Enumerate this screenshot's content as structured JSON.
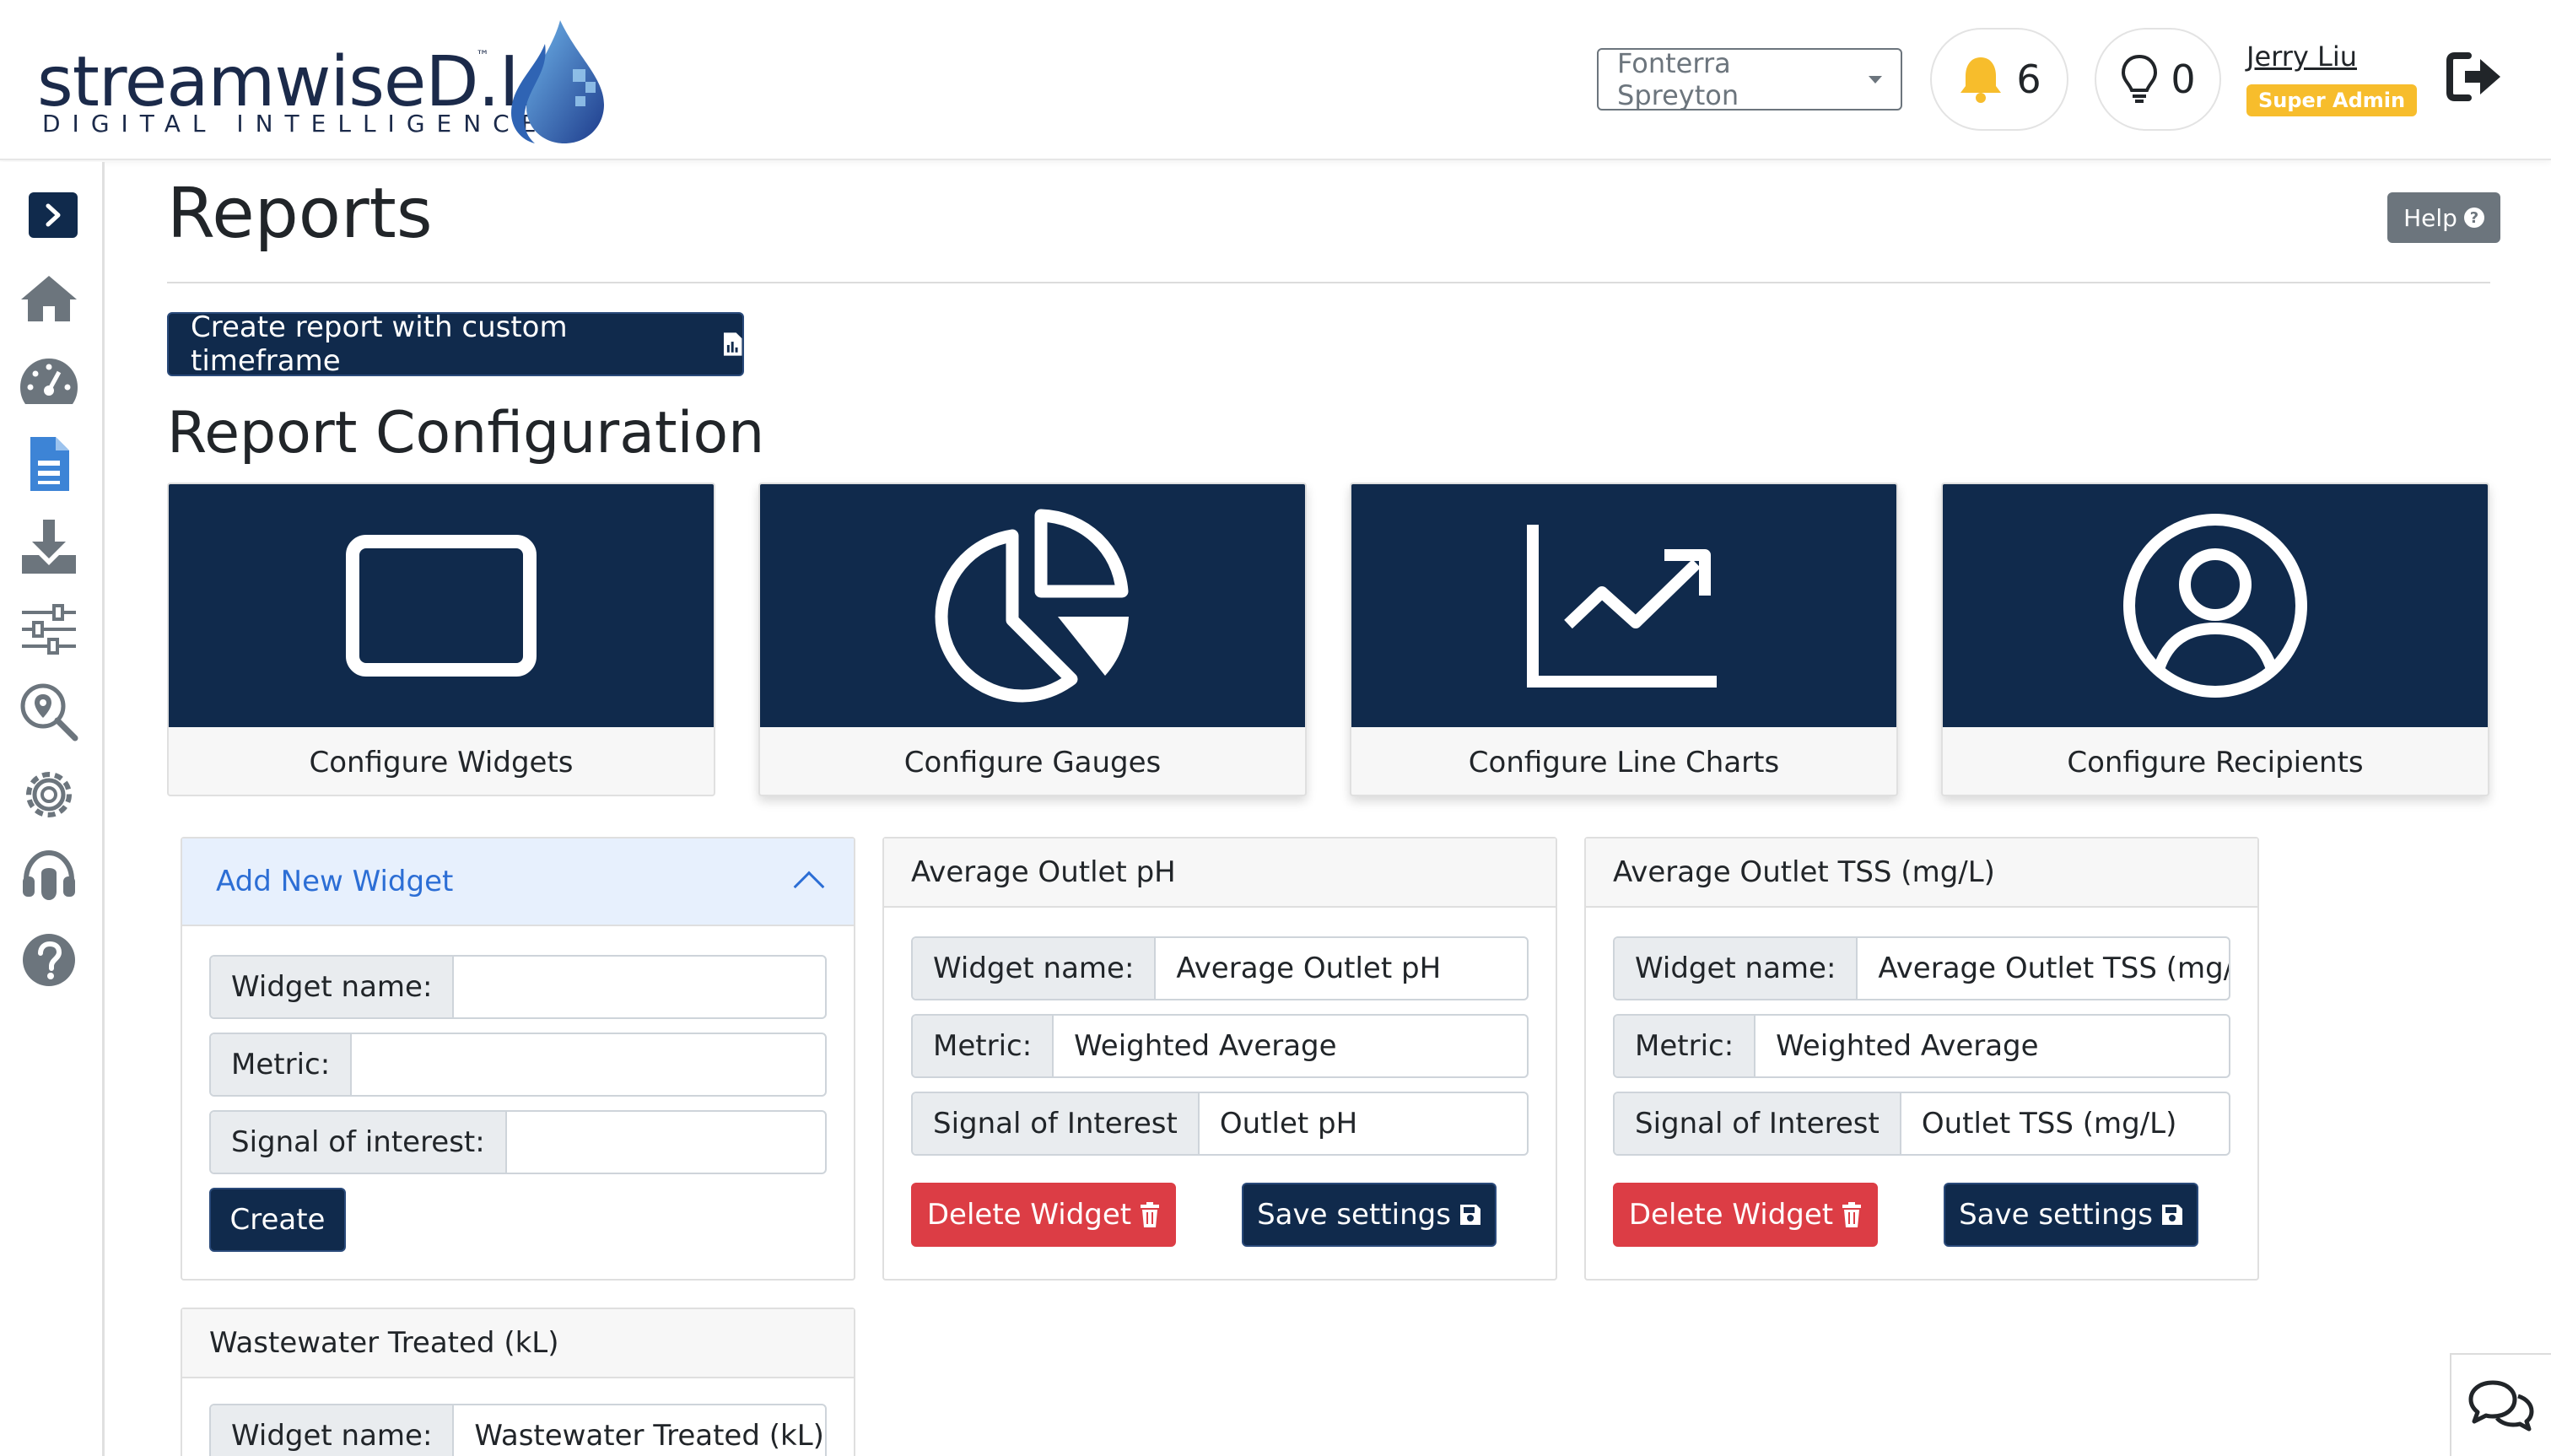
{
  "app": {
    "logo_word_main": "streamwise",
    "logo_word_di": "D.I.",
    "logo_tm": "™",
    "logo_tagline": "DIGITAL INTELLIGENCE"
  },
  "header": {
    "site_selector": "Fonterra Spreyton",
    "notifications_count": "6",
    "ideas_count": "0",
    "user_name": "Jerry Liu",
    "user_role": "Super Admin"
  },
  "sidebar": {
    "items": [
      {
        "icon": "home-icon"
      },
      {
        "icon": "dashboard-gauge-icon"
      },
      {
        "icon": "reports-document-icon",
        "active": true
      },
      {
        "icon": "download-icon"
      },
      {
        "icon": "sliders-icon"
      },
      {
        "icon": "map-search-icon"
      },
      {
        "icon": "settings-gear-icon"
      },
      {
        "icon": "support-headset-icon"
      },
      {
        "icon": "help-question-icon"
      }
    ]
  },
  "page": {
    "title": "Reports",
    "help_label": "Help",
    "custom_report_button": "Create report with custom timeframe",
    "section_title": "Report Configuration"
  },
  "config_cards": [
    {
      "label": "Configure Widgets",
      "icon": "tablet-icon"
    },
    {
      "label": "Configure Gauges",
      "icon": "pie-chart-icon"
    },
    {
      "label": "Configure Line Charts",
      "icon": "line-chart-icon"
    },
    {
      "label": "Configure Recipients",
      "icon": "user-circle-icon"
    }
  ],
  "new_widget": {
    "header": "Add New Widget",
    "name_label": "Widget name:",
    "name_value": "",
    "metric_label": "Metric:",
    "metric_value": "",
    "signal_label": "Signal of interest:",
    "signal_value": "",
    "create_label": "Create"
  },
  "widgets": [
    {
      "title": "Average Outlet pH",
      "name_label": "Widget name:",
      "name_value": "Average Outlet pH",
      "metric_label": "Metric:",
      "metric_value": "Weighted Average",
      "signal_label": "Signal of Interest",
      "signal_value": "Outlet pH",
      "delete_label": "Delete Widget",
      "save_label": "Save settings"
    },
    {
      "title": "Average Outlet TSS (mg/L)",
      "name_label": "Widget name:",
      "name_value": "Average Outlet TSS (mg/L",
      "metric_label": "Metric:",
      "metric_value": "Weighted Average",
      "signal_label": "Signal of Interest",
      "signal_value": "Outlet TSS (mg/L)",
      "delete_label": "Delete Widget",
      "save_label": "Save settings"
    },
    {
      "title": "Wastewater Treated (kL)",
      "name_label": "Widget name:",
      "name_value": "Wastewater Treated (kL)"
    }
  ],
  "colors": {
    "navy": "#102a4c",
    "danger": "#dc3d45",
    "badge": "#f7bd2c",
    "accent_blue": "#2c6ed5"
  }
}
